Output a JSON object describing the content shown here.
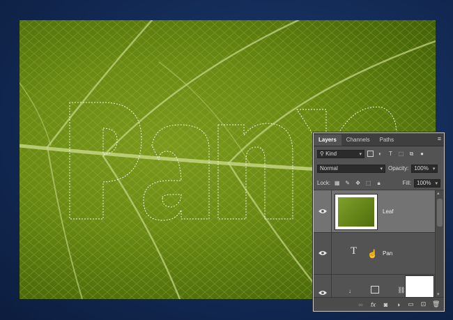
{
  "panel": {
    "tabs": [
      {
        "label": "Layers",
        "active": true
      },
      {
        "label": "Channels",
        "active": false
      },
      {
        "label": "Paths",
        "active": false
      }
    ],
    "filter_label": "Kind",
    "blend_mode": "Normal",
    "opacity_label": "Opacity:",
    "opacity_value": "100%",
    "lock_label": "Lock:",
    "fill_label": "Fill:",
    "fill_value": "100%",
    "layers": [
      {
        "name": "Leaf",
        "selected": true,
        "type": "image"
      },
      {
        "name": "Pan",
        "selected": false,
        "type": "text"
      },
      {
        "name": "",
        "selected": false,
        "type": "fill"
      }
    ]
  },
  "colors": {
    "accent_selected": "#737373",
    "panel_bg": "#535353",
    "leaf_green": "#6a8a14"
  }
}
